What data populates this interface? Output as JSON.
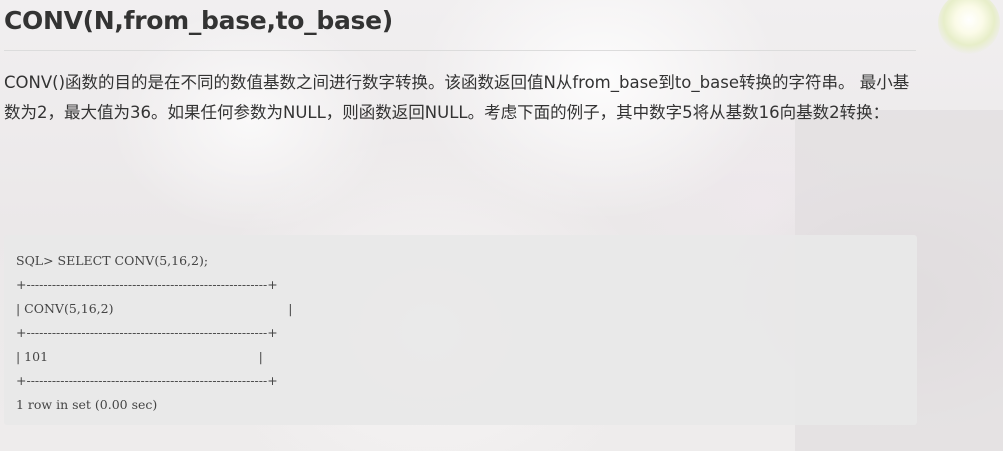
{
  "section": {
    "title": "CONV(N,from_base,to_base)",
    "description": "CONV()函数的目的是在不同的数值基数之间进行数字转换。该函数返回值N从from_base到to_base转换的字符串。 最小基数为2，最大值为36。如果任何参数为NULL，则函数返回NULL。考虑下面的例子，其中数字5将从基数16向基数2转换："
  },
  "code_example": {
    "lines": [
      "SQL> SELECT CONV(5,16,2);",
      "+---------------------------------------------------------+",
      "| CONV(5,16,2)                                            |",
      "+---------------------------------------------------------+",
      "| 101                                                     |",
      "+---------------------------------------------------------+",
      "1 row in set (0.00 sec)"
    ]
  }
}
